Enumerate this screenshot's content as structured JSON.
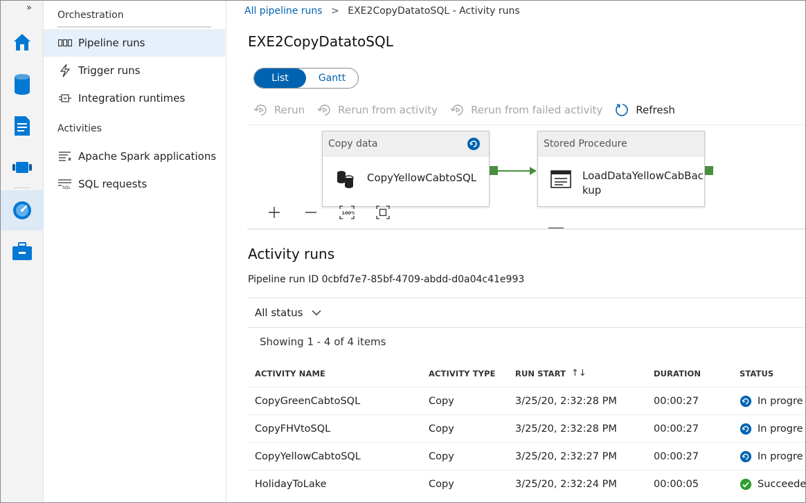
{
  "rail": {
    "expand_glyph": "»",
    "icons": [
      "home-icon",
      "data-icon",
      "develop-icon",
      "orchestrate-icon",
      "monitor-icon",
      "manage-icon"
    ],
    "active": "monitor-icon",
    "accent": "#0078d4"
  },
  "nav": {
    "orchestration_heading": "Orchestration",
    "items": [
      {
        "label": "Pipeline runs",
        "icon": "pipeline-icon",
        "active": true
      },
      {
        "label": "Trigger runs",
        "icon": "trigger-icon"
      },
      {
        "label": "Integration runtimes",
        "icon": "integration-runtime-icon"
      }
    ],
    "activities_heading": "Activities",
    "activity_items": [
      {
        "label": "Apache Spark applications",
        "icon": "spark-apps-icon"
      },
      {
        "label": "SQL requests",
        "icon": "sql-requests-icon"
      }
    ]
  },
  "breadcrumb": {
    "root": "All pipeline runs",
    "separator": ">",
    "current": "EXE2CopyDatatoSQL - Activity runs"
  },
  "page": {
    "title": "EXE2CopyDatatoSQL"
  },
  "view_toggle": {
    "list": "List",
    "gantt": "Gantt",
    "selected": "List"
  },
  "toolbar": {
    "rerun": "Rerun",
    "rerun_from_activity": "Rerun from activity",
    "rerun_from_failed": "Rerun from failed activity",
    "refresh": "Refresh"
  },
  "pipeline_canvas": {
    "activities": [
      {
        "type": "Copy data",
        "name": "CopyYellowCabtoSQL",
        "icon": "copy-data-icon",
        "status_icon": "in-progress-icon"
      },
      {
        "type": "Stored Procedure",
        "name_line1": "LoadDataYellowCabBac",
        "name_line2": "kup",
        "icon": "stored-procedure-icon"
      }
    ],
    "controls": [
      "zoom-in-icon",
      "zoom-out-icon",
      "zoom-100-icon",
      "fit-to-screen-icon"
    ],
    "zoom_100_label": "100%",
    "success_color": "#4a8f3f"
  },
  "activity_runs": {
    "title": "Activity runs",
    "run_id_label": "Pipeline run ID",
    "run_id": "0cbfd7e7-85bf-4709-abdd-d0a04c41e993",
    "filter": "All status",
    "showing": "Showing 1 - 4 of 4 items",
    "columns": [
      "ACTIVITY NAME",
      "ACTIVITY TYPE",
      "RUN START",
      "DURATION",
      "STATUS"
    ],
    "sort_glyph": "↑↓",
    "rows": [
      {
        "name": "CopyGreenCabtoSQL",
        "type": "Copy",
        "start": "3/25/20, 2:32:28 PM",
        "duration": "00:00:27",
        "status": "In progre",
        "status_icon": "in-progress-icon"
      },
      {
        "name": "CopyFHVtoSQL",
        "type": "Copy",
        "start": "3/25/20, 2:32:28 PM",
        "duration": "00:00:27",
        "status": "In progre",
        "status_icon": "in-progress-icon"
      },
      {
        "name": "CopyYellowCabtoSQL",
        "type": "Copy",
        "start": "3/25/20, 2:32:27 PM",
        "duration": "00:00:27",
        "status": "In progre",
        "status_icon": "in-progress-icon"
      },
      {
        "name": "HolidayToLake",
        "type": "Copy",
        "start": "3/25/20, 2:32:24 PM",
        "duration": "00:00:05",
        "status": "Succeede",
        "status_icon": "success-icon"
      }
    ],
    "in_progress_color": "#0063b1",
    "success_color": "#2f9e2f"
  }
}
